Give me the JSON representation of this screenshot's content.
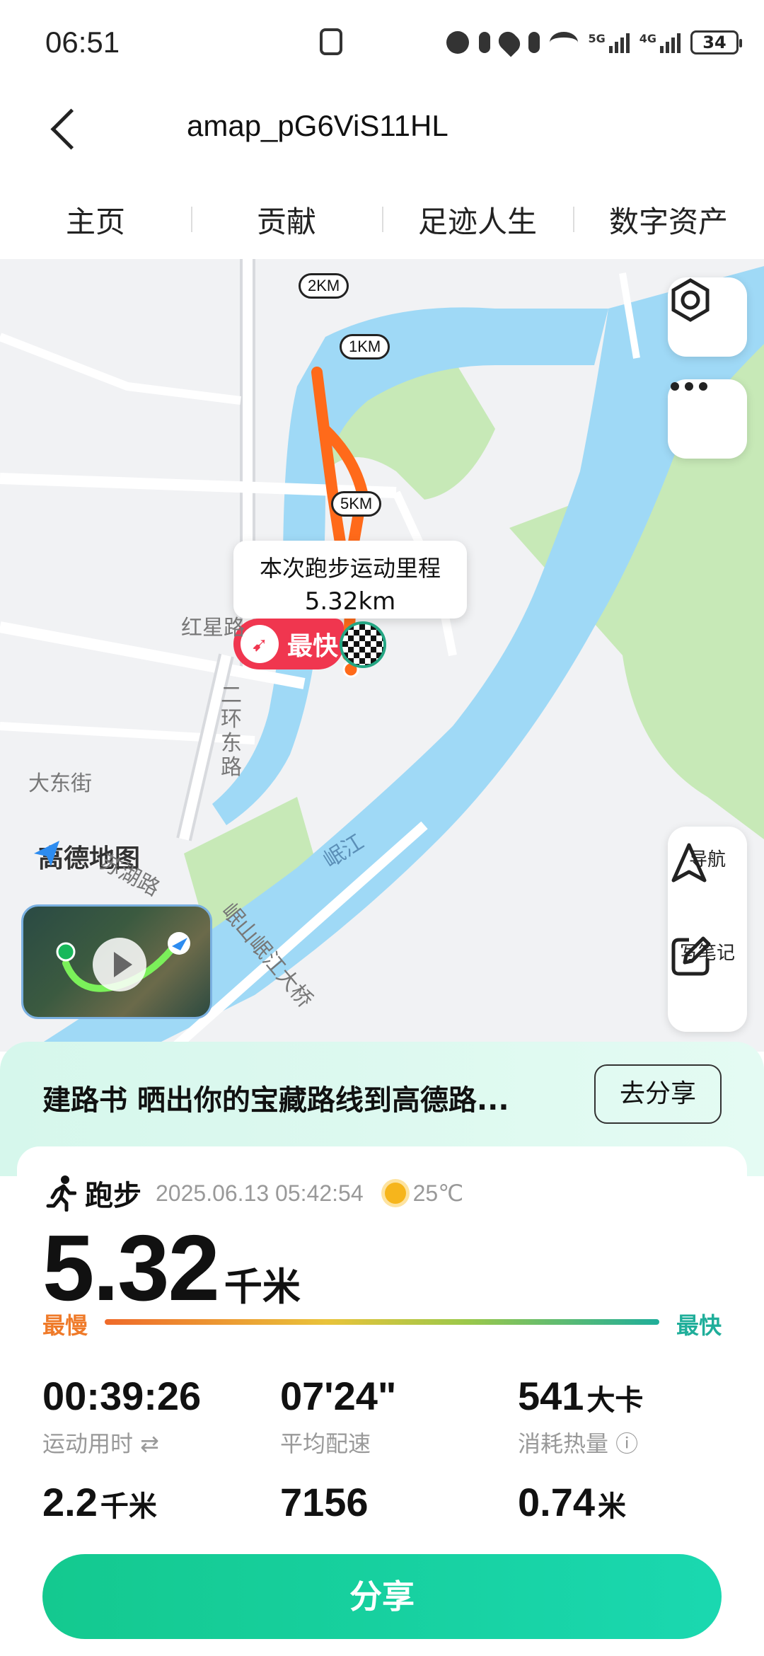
{
  "status_bar": {
    "time": "06:51",
    "battery": "34",
    "network_labels": [
      "5G",
      "4G"
    ]
  },
  "header": {
    "title": "amap_pG6ViS11HL"
  },
  "tabs": [
    {
      "label": "主页"
    },
    {
      "label": "贡献"
    },
    {
      "label": "足迹人生"
    },
    {
      "label": "数字资产"
    }
  ],
  "map": {
    "km_markers": [
      "2KM",
      "1KM",
      "5KM"
    ],
    "popup_title": "本次跑步运动里程",
    "popup_distance": "5.32km",
    "fastest_tag": "最快",
    "nav_label": "导航",
    "note_label": "写笔记",
    "logo_text": "高德地图",
    "place_labels": [
      "红星路",
      "二环东路",
      "大东街",
      "苏湖路",
      "岷江",
      "岷山岷江大桥"
    ],
    "colors": {
      "water": "#9fd9f6",
      "park": "#c7e9b7",
      "route": "#ff6a1a",
      "fast_tag": "#f0364f"
    }
  },
  "banner": {
    "text": "建路书 晒出你的宝藏路线到高德路...",
    "button": "去分享"
  },
  "activity": {
    "type": "跑步",
    "datetime": "2025.06.13 05:42:54",
    "temperature": "25℃",
    "distance_value": "5.32",
    "distance_unit": "千米",
    "pace_slow_label": "最慢",
    "pace_fast_label": "最快",
    "stats": [
      {
        "value": "00:39:26",
        "unit": "",
        "label": "运动用时 ⇄"
      },
      {
        "value": "07'24\"",
        "unit": "",
        "label": "平均配速"
      },
      {
        "value": "541",
        "unit": "大卡",
        "label": "消耗热量 ⓘ"
      },
      {
        "value": "2.2",
        "unit": "千米",
        "label": ""
      },
      {
        "value": "7156",
        "unit": "",
        "label": ""
      },
      {
        "value": "0.74",
        "unit": "米",
        "label": ""
      }
    ]
  },
  "share_button": "分享",
  "accent_color": "#14c98f"
}
